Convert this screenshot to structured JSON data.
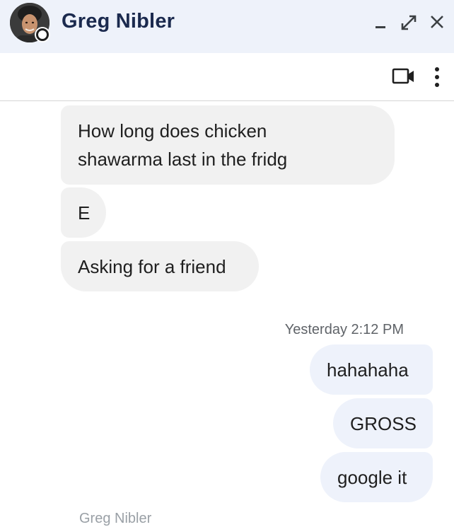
{
  "header": {
    "name": "Greg Nibler",
    "background_color": "#eef2fa",
    "name_color": "#1b2a4e",
    "actions": {
      "minimize_icon": "minimize-icon",
      "popout_icon": "popout-icon",
      "close_icon": "close-icon"
    }
  },
  "toolbar": {
    "video_icon": "video-camera-icon",
    "more_icon": "more-vert-icon"
  },
  "messages": {
    "incoming": [
      {
        "text_line1": "How long does chicken",
        "text_line2": "shawarma last in the fridg"
      },
      {
        "text": "E"
      },
      {
        "text": "Asking for a friend"
      }
    ],
    "timestamp": "Yesterday 2:12 PM",
    "outgoing": [
      {
        "text": "hahahaha"
      },
      {
        "text": "GROSS"
      },
      {
        "text": "google it"
      }
    ],
    "incoming_color": "#f1f1f1",
    "outgoing_color": "#eef2fb"
  },
  "footer": {
    "partial_sender_name": "Greg Nibler"
  }
}
